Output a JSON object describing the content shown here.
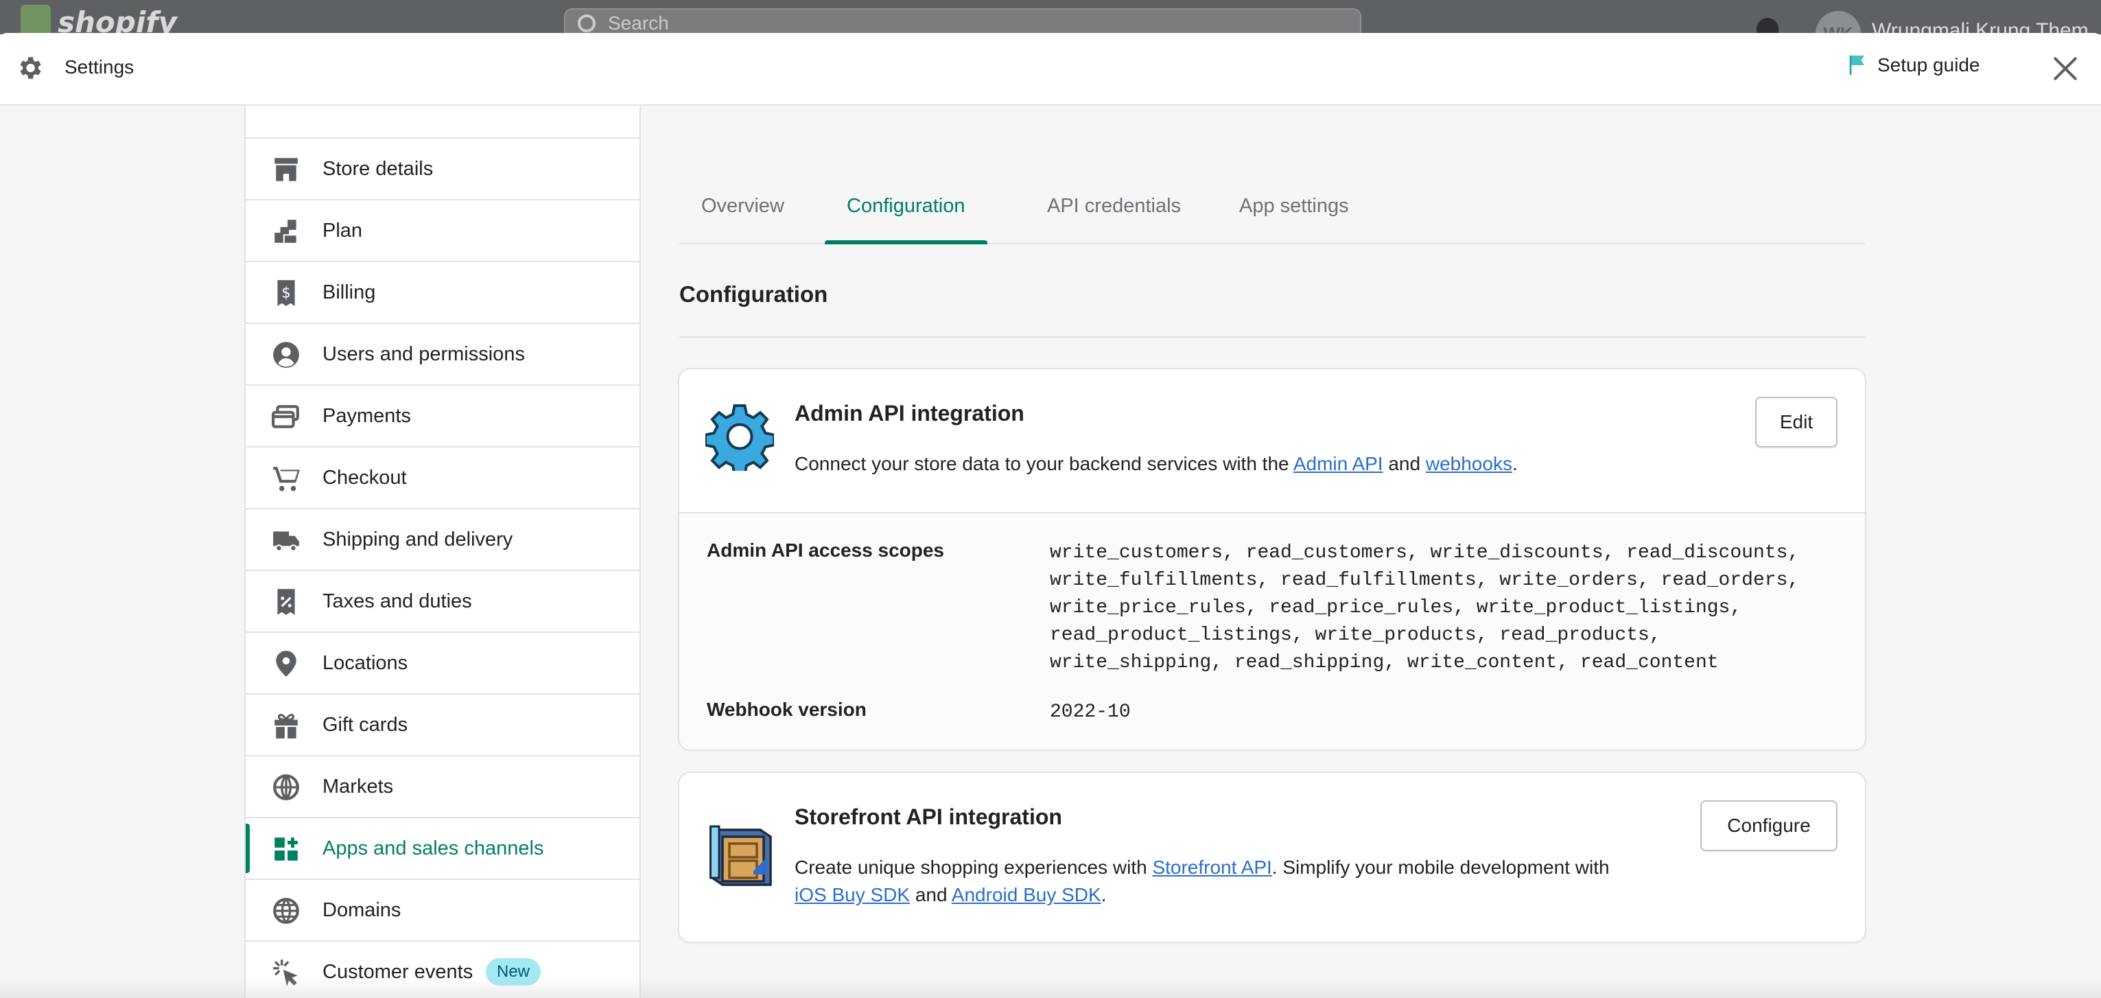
{
  "background": {
    "logo_text": "shopify",
    "search_placeholder": "Search",
    "avatar_initials": "WK",
    "user_name": "Wrungmali Krung Them"
  },
  "header": {
    "title": "Settings",
    "setup_guide_label": "Setup guide"
  },
  "sidebar": {
    "items": [
      {
        "label": "Store details",
        "icon": "store-icon"
      },
      {
        "label": "Plan",
        "icon": "plan-icon"
      },
      {
        "label": "Billing",
        "icon": "billing-icon"
      },
      {
        "label": "Users and permissions",
        "icon": "user-icon"
      },
      {
        "label": "Payments",
        "icon": "payments-icon"
      },
      {
        "label": "Checkout",
        "icon": "cart-icon"
      },
      {
        "label": "Shipping and delivery",
        "icon": "truck-icon"
      },
      {
        "label": "Taxes and duties",
        "icon": "tax-icon"
      },
      {
        "label": "Locations",
        "icon": "location-pin-icon"
      },
      {
        "label": "Gift cards",
        "icon": "gift-icon"
      },
      {
        "label": "Markets",
        "icon": "markets-globe-icon"
      },
      {
        "label": "Apps and sales channels",
        "icon": "apps-icon",
        "active": true
      },
      {
        "label": "Domains",
        "icon": "globe-icon"
      },
      {
        "label": "Customer events",
        "icon": "cursor-click-icon",
        "badge": "New"
      }
    ]
  },
  "tabs": [
    {
      "label": "Overview"
    },
    {
      "label": "Configuration",
      "active": true
    },
    {
      "label": "API credentials"
    },
    {
      "label": "App settings"
    }
  ],
  "page": {
    "heading": "Configuration"
  },
  "admin_card": {
    "title": "Admin API integration",
    "desc_prefix": "Connect your store data to your backend services with the ",
    "link1": "Admin API",
    "desc_mid": " and ",
    "link2": "webhooks",
    "desc_suffix": ".",
    "edit_label": "Edit",
    "scopes_label": "Admin API access scopes",
    "scopes_lines": [
      "write_customers, read_customers, write_discounts, read_discounts,",
      "write_fulfillments, read_fulfillments, write_orders, read_orders,",
      "write_price_rules, read_price_rules, write_product_listings,",
      "read_product_listings, write_products, read_products,",
      "write_shipping, read_shipping, write_content, read_content"
    ],
    "webhook_label": "Webhook version",
    "webhook_value": "2022-10"
  },
  "storefront_card": {
    "title": "Storefront API integration",
    "desc_prefix": "Create unique shopping experiences with ",
    "link1": "Storefront API",
    "desc_mid": ". Simplify your mobile development with",
    "link2": "iOS Buy SDK",
    "desc_and": " and ",
    "link3": "Android Buy SDK",
    "desc_suffix": ".",
    "configure_label": "Configure"
  },
  "colors": {
    "accent": "#008060",
    "link": "#2c6ecb",
    "badge_bg": "#a4e8f2"
  }
}
